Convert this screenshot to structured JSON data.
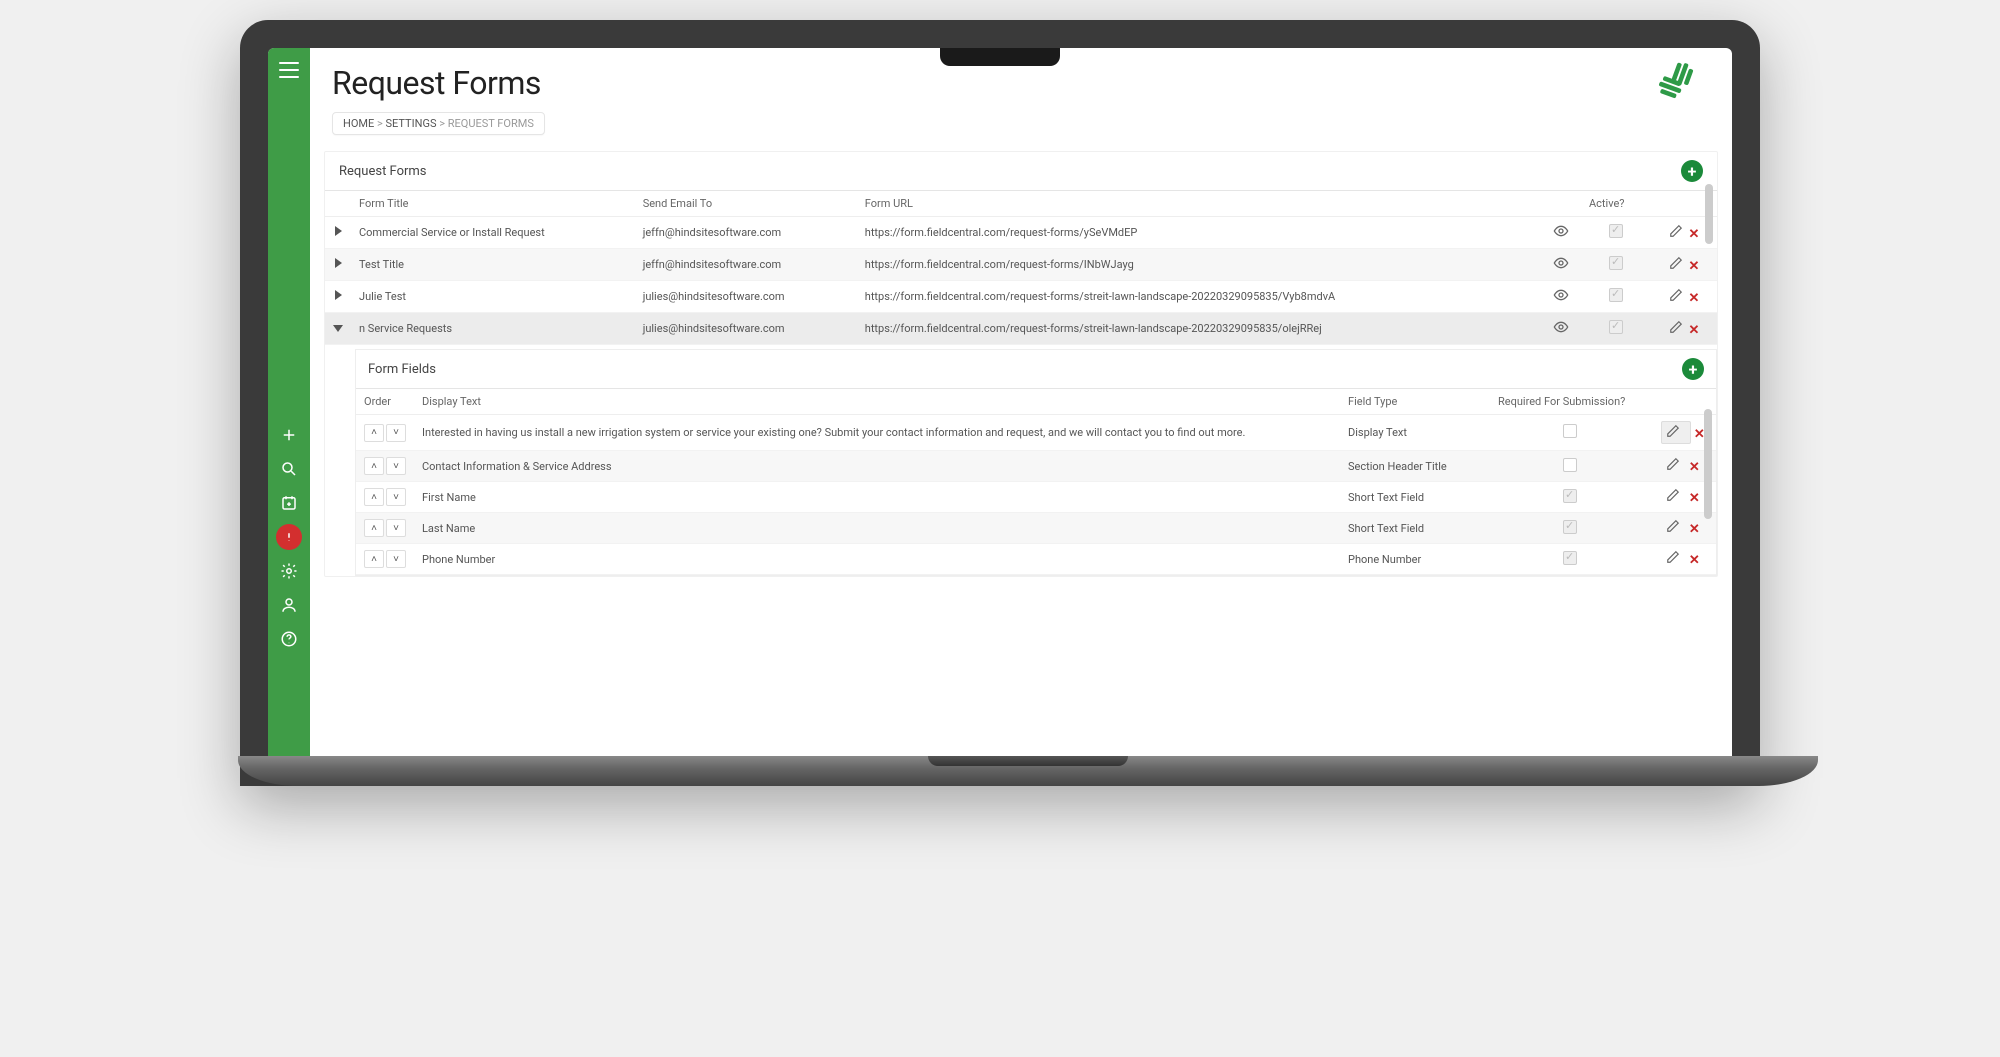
{
  "header": {
    "title": "Request Forms"
  },
  "breadcrumb": {
    "home": "HOME",
    "settings": "SETTINGS",
    "current": "REQUEST FORMS",
    "sep": ">"
  },
  "forms_panel": {
    "title": "Request Forms",
    "columns": {
      "title": "Form Title",
      "email": "Send Email To",
      "url": "Form URL",
      "active": "Active?"
    },
    "rows": [
      {
        "expanded": false,
        "title": "Commercial Service or Install Request",
        "email": "jeffn@hindsitesoftware.com",
        "url": "https://form.fieldcentral.com/request-forms/ySeVMdEP",
        "active": true,
        "alt": false
      },
      {
        "expanded": false,
        "title": "Test Title",
        "email": "jeffn@hindsitesoftware.com",
        "url": "https://form.fieldcentral.com/request-forms/INbWJayg",
        "active": true,
        "alt": true
      },
      {
        "expanded": false,
        "title": "Julie Test",
        "email": "julies@hindsitesoftware.com",
        "url": "https://form.fieldcentral.com/request-forms/streit-lawn-landscape-20220329095835/Vyb8mdvA",
        "active": true,
        "alt": false
      },
      {
        "expanded": true,
        "title": "n Service Requests",
        "email": "julies@hindsitesoftware.com",
        "url": "https://form.fieldcentral.com/request-forms/streit-lawn-landscape-20220329095835/olejRRej",
        "active": true,
        "alt": false,
        "selected": true
      }
    ]
  },
  "fields_panel": {
    "title": "Form Fields",
    "columns": {
      "order": "Order",
      "display": "Display Text",
      "type": "Field Type",
      "required": "Required For Submission?"
    },
    "rows": [
      {
        "text": "Interested in having us install a new irrigation system or service your existing one? Submit your contact information and request, and we will contact you to find out more.",
        "type": "Display Text",
        "required": false,
        "req_editable": true,
        "edit_highlight": true,
        "alt": false
      },
      {
        "text": "Contact Information & Service Address",
        "type": "Section Header Title",
        "required": false,
        "req_editable": true,
        "edit_highlight": false,
        "alt": true
      },
      {
        "text": "First Name",
        "type": "Short Text Field",
        "required": true,
        "req_editable": false,
        "edit_highlight": false,
        "alt": false
      },
      {
        "text": "Last Name",
        "type": "Short Text Field",
        "required": true,
        "req_editable": false,
        "edit_highlight": false,
        "alt": true
      },
      {
        "text": "Phone Number",
        "type": "Phone Number",
        "required": true,
        "req_editable": false,
        "edit_highlight": false,
        "alt": false
      }
    ]
  }
}
